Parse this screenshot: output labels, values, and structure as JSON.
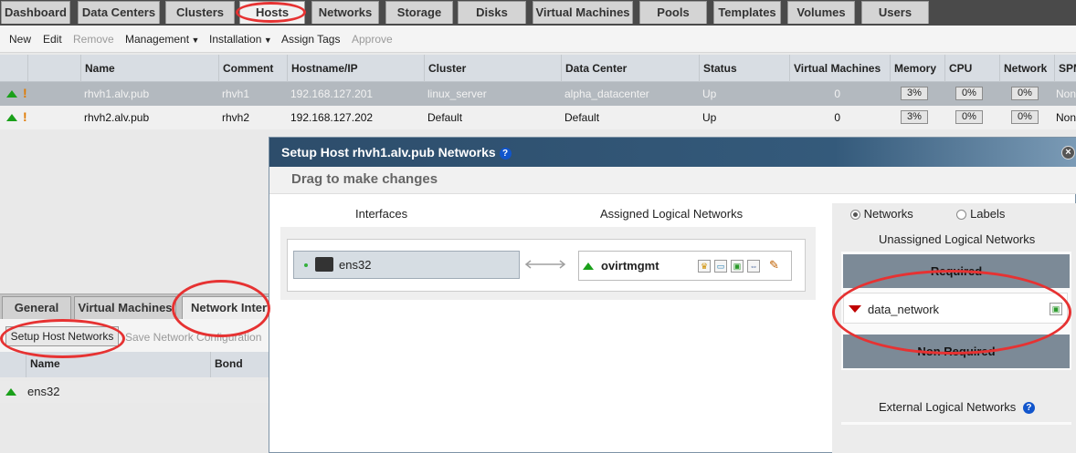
{
  "top_tabs": [
    {
      "label": "Dashboard"
    },
    {
      "label": "Data Centers"
    },
    {
      "label": "Clusters"
    },
    {
      "label": "Hosts"
    },
    {
      "label": "Networks"
    },
    {
      "label": "Storage"
    },
    {
      "label": "Disks"
    },
    {
      "label": "Virtual Machines"
    },
    {
      "label": "Pools"
    },
    {
      "label": "Templates"
    },
    {
      "label": "Volumes"
    },
    {
      "label": "Users"
    }
  ],
  "actions": {
    "new": "New",
    "edit": "Edit",
    "remove": "Remove",
    "management": "Management",
    "installation": "Installation",
    "assign_tags": "Assign Tags",
    "approve": "Approve"
  },
  "hosts_table": {
    "headers": {
      "name": "Name",
      "comment": "Comment",
      "hostname": "Hostname/IP",
      "cluster": "Cluster",
      "datacenter": "Data Center",
      "status": "Status",
      "vms": "Virtual Machines",
      "memory": "Memory",
      "cpu": "CPU",
      "network": "Network",
      "spm": "SPM"
    },
    "rows": [
      {
        "name": "rhvh1.alv.pub",
        "comment": "rhvh1",
        "hostname": "192.168.127.201",
        "cluster": "linux_server",
        "datacenter": "alpha_datacenter",
        "status": "Up",
        "vms": "0",
        "memory": "3%",
        "cpu": "0%",
        "network": "0%",
        "spm": "None"
      },
      {
        "name": "rhvh2.alv.pub",
        "comment": "rhvh2",
        "hostname": "192.168.127.202",
        "cluster": "Default",
        "datacenter": "Default",
        "status": "Up",
        "vms": "0",
        "memory": "3%",
        "cpu": "0%",
        "network": "0%",
        "spm": "None"
      }
    ]
  },
  "lower": {
    "tabs": [
      {
        "label": "General"
      },
      {
        "label": "Virtual Machines"
      },
      {
        "label": "Network Interfaces"
      }
    ],
    "setup_button": "Setup Host Networks",
    "save_config": "Save Network Configuration",
    "headers": {
      "name": "Name",
      "bond": "Bond"
    },
    "rows": [
      {
        "name": "ens32"
      }
    ]
  },
  "dialog": {
    "title": "Setup Host rhvh1.alv.pub Networks",
    "subtitle": "Drag to make changes",
    "interfaces_header": "Interfaces",
    "assigned_header": "Assigned Logical Networks",
    "interface_name": "ens32",
    "assigned_network": "ovirtmgmt",
    "radio_networks": "Networks",
    "radio_labels": "Labels",
    "unassigned_header": "Unassigned Logical Networks",
    "required": "Required",
    "unassigned_network": "data_network",
    "non_required": "Non Required",
    "external": "External Logical Networks"
  },
  "colors": {
    "annotation": "#e63232",
    "up_green": "#1aa01a",
    "down_red": "#c00000",
    "title_bar": "#2d4d6b"
  }
}
